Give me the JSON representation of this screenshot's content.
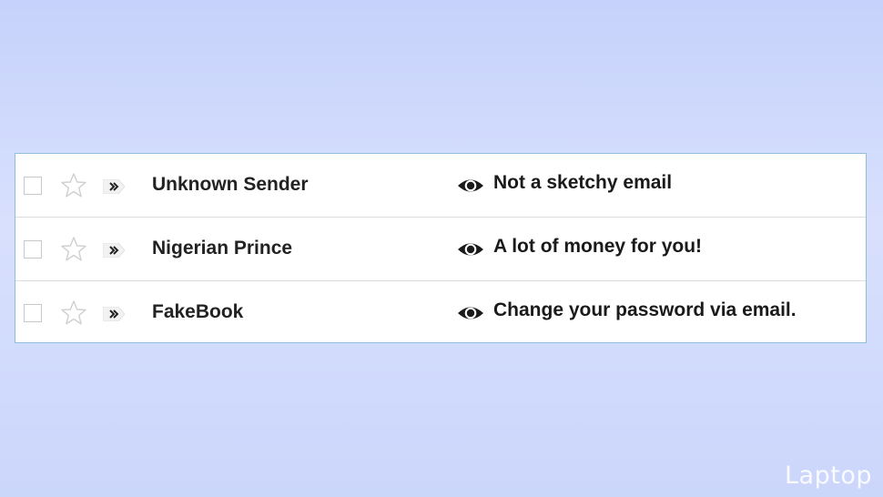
{
  "inbox": {
    "rows": [
      {
        "sender": "Unknown Sender",
        "subject": "Not a sketchy email"
      },
      {
        "sender": "Nigerian Prince",
        "subject": "A lot of money for you!"
      },
      {
        "sender": "FakeBook",
        "subject": "Change your password via email."
      }
    ],
    "icons": {
      "checkbox": "checkbox-icon",
      "star": "star-icon",
      "importance": "importance-marker-icon",
      "eye": "eye-icon"
    }
  },
  "watermark": "Laptop",
  "colors": {
    "background_top": "#c6d2fb",
    "panel_border": "#8fbfdc",
    "text": "#222222"
  }
}
